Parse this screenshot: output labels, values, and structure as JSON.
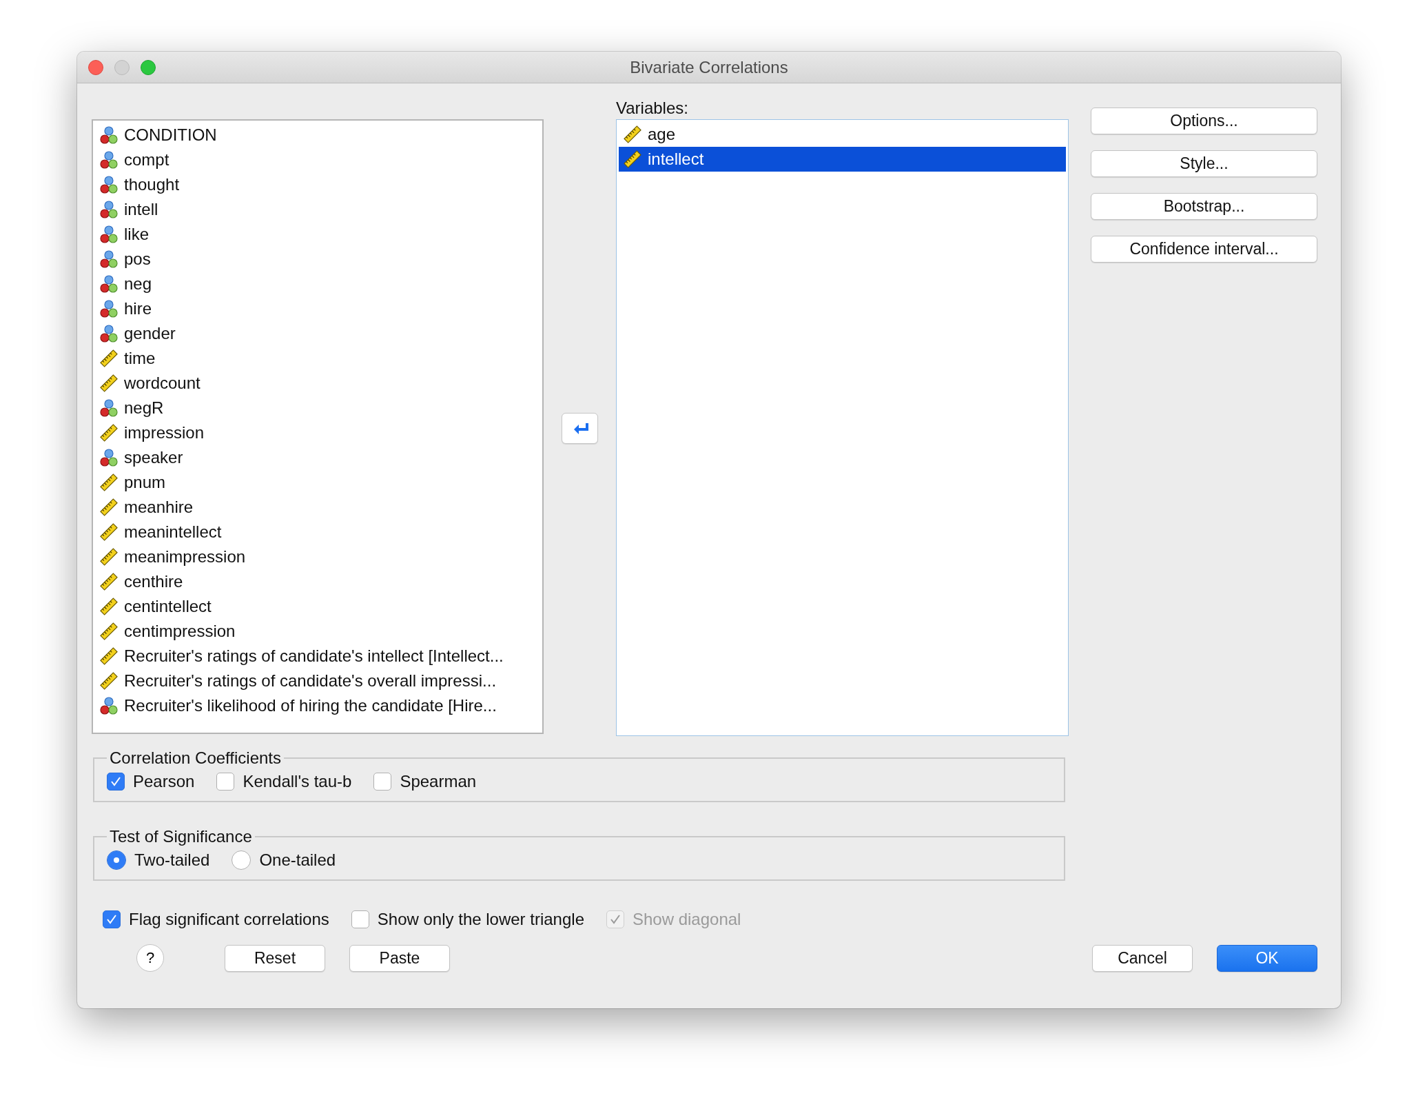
{
  "window": {
    "title": "Bivariate Correlations"
  },
  "source_list": {
    "items": [
      {
        "name": "CONDITION",
        "kind": "nominal",
        "selected": false
      },
      {
        "name": "compt",
        "kind": "nominal",
        "selected": false
      },
      {
        "name": "thought",
        "kind": "nominal",
        "selected": false
      },
      {
        "name": "intell",
        "kind": "nominal",
        "selected": false
      },
      {
        "name": "like",
        "kind": "nominal",
        "selected": false
      },
      {
        "name": "pos",
        "kind": "nominal",
        "selected": false
      },
      {
        "name": "neg",
        "kind": "nominal",
        "selected": false
      },
      {
        "name": "hire",
        "kind": "nominal",
        "selected": false
      },
      {
        "name": "gender",
        "kind": "nominal",
        "selected": false
      },
      {
        "name": "time",
        "kind": "scale",
        "selected": false
      },
      {
        "name": "wordcount",
        "kind": "scale",
        "selected": false
      },
      {
        "name": "negR",
        "kind": "nominal",
        "selected": false
      },
      {
        "name": "impression",
        "kind": "scale",
        "selected": false
      },
      {
        "name": "speaker",
        "kind": "nominal",
        "selected": false
      },
      {
        "name": "pnum",
        "kind": "scale",
        "selected": false
      },
      {
        "name": "meanhire",
        "kind": "scale",
        "selected": false
      },
      {
        "name": "meanintellect",
        "kind": "scale",
        "selected": false
      },
      {
        "name": "meanimpression",
        "kind": "scale",
        "selected": false
      },
      {
        "name": "centhire",
        "kind": "scale",
        "selected": false
      },
      {
        "name": "centintellect",
        "kind": "scale",
        "selected": false
      },
      {
        "name": "centimpression",
        "kind": "scale",
        "selected": false
      },
      {
        "name": "Recruiter's ratings of candidate's intellect [Intellect...",
        "kind": "scale",
        "selected": false
      },
      {
        "name": "Recruiter's ratings of candidate's overall impressi...",
        "kind": "scale",
        "selected": false
      },
      {
        "name": "Recruiter's likelihood of hiring the candidate [Hire...",
        "kind": "nominal",
        "selected": false
      }
    ]
  },
  "variables": {
    "label": "Variables:",
    "items": [
      {
        "name": "age",
        "kind": "scale",
        "selected": false
      },
      {
        "name": "intellect",
        "kind": "scale",
        "selected": true
      }
    ]
  },
  "side_buttons": [
    "Options...",
    "Style...",
    "Bootstrap...",
    "Confidence interval..."
  ],
  "correlation_coefficients": {
    "title": "Correlation Coefficients",
    "options": [
      {
        "label": "Pearson",
        "checked": true
      },
      {
        "label": "Kendall's tau-b",
        "checked": false
      },
      {
        "label": "Spearman",
        "checked": false
      }
    ]
  },
  "test_of_significance": {
    "title": "Test of Significance",
    "options": [
      {
        "label": "Two-tailed",
        "selected": true
      },
      {
        "label": "One-tailed",
        "selected": false
      }
    ]
  },
  "display_options": [
    {
      "label": "Flag significant correlations",
      "checked": true,
      "disabled": false
    },
    {
      "label": "Show only the lower triangle",
      "checked": false,
      "disabled": false
    },
    {
      "label": "Show diagonal",
      "checked": true,
      "disabled": true
    }
  ],
  "footer": {
    "help": "?",
    "left_buttons": [
      "Reset",
      "Paste"
    ],
    "right_buttons": [
      {
        "label": "Cancel",
        "kind": "normal"
      },
      {
        "label": "OK",
        "kind": "default"
      }
    ]
  }
}
